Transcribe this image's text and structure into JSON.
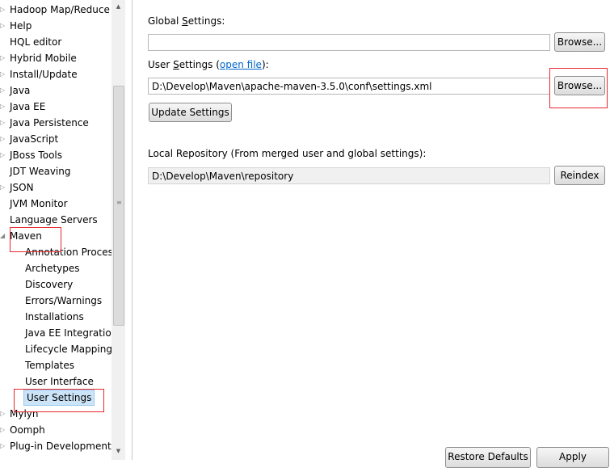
{
  "tree": {
    "items": [
      {
        "label": "Hadoop Map/Reduce",
        "arrow": "▷",
        "level": 0
      },
      {
        "label": "Help",
        "arrow": "▷",
        "level": 0
      },
      {
        "label": "HQL editor",
        "arrow": "",
        "level": 0
      },
      {
        "label": "Hybrid Mobile",
        "arrow": "▷",
        "level": 0
      },
      {
        "label": "Install/Update",
        "arrow": "▷",
        "level": 0
      },
      {
        "label": "Java",
        "arrow": "▷",
        "level": 0
      },
      {
        "label": "Java EE",
        "arrow": "▷",
        "level": 0
      },
      {
        "label": "Java Persistence",
        "arrow": "▷",
        "level": 0
      },
      {
        "label": "JavaScript",
        "arrow": "▷",
        "level": 0
      },
      {
        "label": "JBoss Tools",
        "arrow": "▷",
        "level": 0
      },
      {
        "label": "JDT Weaving",
        "arrow": "",
        "level": 0
      },
      {
        "label": "JSON",
        "arrow": "▷",
        "level": 0
      },
      {
        "label": "JVM Monitor",
        "arrow": "",
        "level": 0
      },
      {
        "label": "Language Servers",
        "arrow": "",
        "level": 0
      },
      {
        "label": "Maven",
        "arrow": "◢",
        "level": 0
      },
      {
        "label": "Annotation Processing",
        "arrow": "",
        "level": 1
      },
      {
        "label": "Archetypes",
        "arrow": "",
        "level": 1
      },
      {
        "label": "Discovery",
        "arrow": "",
        "level": 1
      },
      {
        "label": "Errors/Warnings",
        "arrow": "",
        "level": 1
      },
      {
        "label": "Installations",
        "arrow": "",
        "level": 1
      },
      {
        "label": "Java EE Integration",
        "arrow": "",
        "level": 1
      },
      {
        "label": "Lifecycle Mappings",
        "arrow": "",
        "level": 1
      },
      {
        "label": "Templates",
        "arrow": "",
        "level": 1
      },
      {
        "label": "User Interface",
        "arrow": "",
        "level": 1
      },
      {
        "label": "User Settings",
        "arrow": "",
        "level": 1,
        "selected": true
      },
      {
        "label": "Mylyn",
        "arrow": "▷",
        "level": 0
      },
      {
        "label": "Oomph",
        "arrow": "▷",
        "level": 0
      },
      {
        "label": "Plug-in Development",
        "arrow": "▷",
        "level": 0
      }
    ],
    "scroll_up": "▲",
    "scroll_down": "▼",
    "grip": "≡"
  },
  "global": {
    "label_pre": "Global ",
    "label_mnemonic": "S",
    "label_post": "ettings:",
    "value": "",
    "browse_label": "Browse..."
  },
  "user": {
    "label_pre": "User ",
    "label_mnemonic": "S",
    "label_mid": "ettings (",
    "link": "open file",
    "label_post": "):",
    "value": "D:\\Develop\\Maven\\apache-maven-3.5.0\\conf\\settings.xml",
    "browse_label": "Browse...",
    "update_label": "Update Settings"
  },
  "local_repo": {
    "label": "Local Repository (From merged user and global settings):",
    "value": "D:\\Develop\\Maven\\repository",
    "reindex_label": "Reindex"
  },
  "footer": {
    "restore_label": "Restore Defaults",
    "apply_label": "Apply"
  },
  "annotation_color": "#e8282f"
}
